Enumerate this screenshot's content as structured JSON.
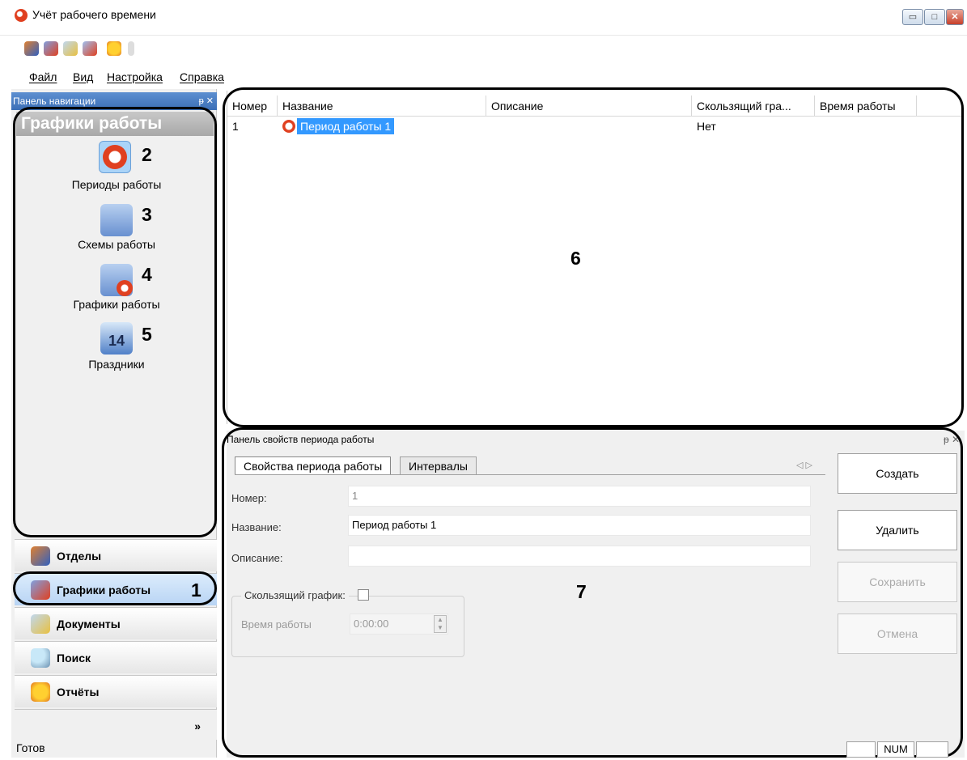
{
  "window": {
    "title": "Учёт рабочего времени",
    "minimize": "▭",
    "maximize": "□",
    "close": "✕"
  },
  "menu": {
    "file": "Файл",
    "view": "Вид",
    "settings": "Настройка",
    "help": "Справка"
  },
  "nav": {
    "header": "Панель навигации",
    "pin": "ᵽ ✕",
    "title": "Графики работы",
    "items": [
      {
        "label": "Периоды работы",
        "num": "2",
        "icon": "clock-icon"
      },
      {
        "label": "Схемы работы",
        "num": "3",
        "icon": "calendar-icon"
      },
      {
        "label": "Графики работы",
        "num": "4",
        "icon": "calendar-clock-icon"
      },
      {
        "label": "Праздники",
        "num": "5",
        "icon": "holiday-calendar-icon"
      }
    ],
    "buttons": [
      {
        "label": "Отделы",
        "icon": "users-icon"
      },
      {
        "label": "Графики работы",
        "icon": "calendar-clock-icon"
      },
      {
        "label": "Документы",
        "icon": "document-icon"
      },
      {
        "label": "Поиск",
        "icon": "search-icon"
      },
      {
        "label": "Отчёты",
        "icon": "report-icon"
      }
    ],
    "selected_num": "1",
    "more": "»"
  },
  "grid": {
    "columns": [
      "Номер",
      "Название",
      "Описание",
      "Скользящий гра...",
      "Время работы"
    ],
    "rows": [
      {
        "number": "1",
        "name": "Период работы 1",
        "description": "",
        "sliding": "Нет",
        "time": ""
      }
    ],
    "callout": "6"
  },
  "props": {
    "header": "Панель свойств периода работы",
    "pin": "ᵽ ✕",
    "tabs": [
      "Свойства периода работы",
      "Интервалы"
    ],
    "tab_arrows": "◁ ▷",
    "number_label": "Номер:",
    "number_value": "1",
    "name_label": "Название:",
    "name_value": "Период работы 1",
    "desc_label": "Описание:",
    "desc_value": "",
    "sliding_label": "Скользящий график:",
    "worktime_label": "Время работы",
    "worktime_value": "0:00:00",
    "callout": "7",
    "btn_create": "Создать",
    "btn_delete": "Удалить",
    "btn_save": "Сохранить",
    "btn_cancel": "Отмена"
  },
  "status": {
    "text": "Готов",
    "num": "NUM"
  }
}
